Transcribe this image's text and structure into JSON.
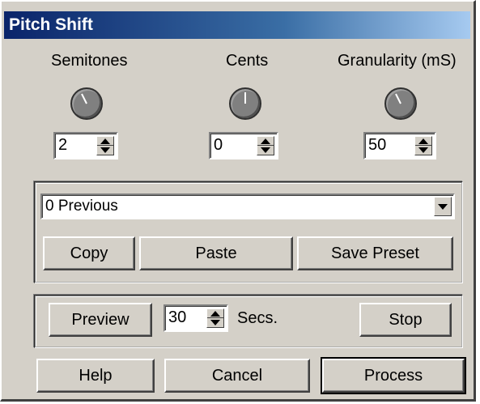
{
  "window": {
    "title": "Pitch Shift",
    "background": "#d4d0c8",
    "titlebar_color": "#0a246a"
  },
  "controls": [
    {
      "label": "Semitones",
      "value": "2",
      "knob_angle": -30
    },
    {
      "label": "Cents",
      "value": "0",
      "knob_angle": 0
    },
    {
      "label": "Granularity (mS)",
      "value": "50",
      "knob_angle": -30
    }
  ],
  "presets": {
    "selected": "0 Previous",
    "copy_label": "Copy",
    "paste_label": "Paste",
    "save_label": "Save Preset"
  },
  "preview": {
    "preview_label": "Preview",
    "seconds_value": "30",
    "seconds_unit": "Secs.",
    "stop_label": "Stop"
  },
  "footer": {
    "help_label": "Help",
    "cancel_label": "Cancel",
    "process_label": "Process"
  }
}
